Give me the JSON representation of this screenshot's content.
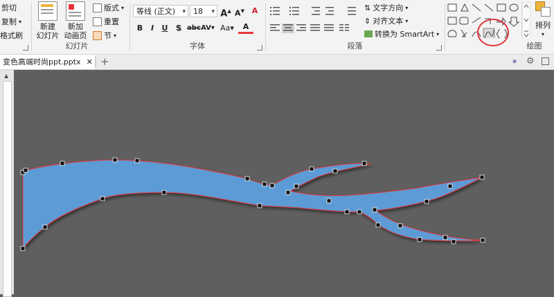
{
  "ribbon": {
    "clipboard": {
      "cut": "剪切",
      "copy": "复制",
      "format_painter": "格式刷"
    },
    "slides": {
      "new_slide": "新建幻灯片",
      "new_slide_line1": "新建",
      "new_slide_line2": "幻灯片",
      "new_anim_page_line1": "新加",
      "new_anim_page_line2": "动画页",
      "layout": "版式",
      "reset": "重置",
      "section": "节",
      "label": "幻灯片"
    },
    "font": {
      "font_name": "等线 (正文)",
      "font_size": "18",
      "bold": "B",
      "italic": "I",
      "underline": "U",
      "shadow": "S",
      "spacing": "AV",
      "case": "Aa",
      "label": "字体"
    },
    "paragraph": {
      "text_direction": "文字方向",
      "align_text": "对齐文本",
      "smartart": "转换为 SmartArt",
      "label": "段落"
    },
    "drawing": {
      "arrange": "排列",
      "label": "绘图"
    }
  },
  "document_tab": {
    "title": "变色高端时尚ppt.pptx",
    "close": "✕",
    "add": "+"
  },
  "colors": {
    "shape_fill": "#5b9bd5",
    "shape_outline": "#e8343a",
    "highlight": "#e0393c",
    "canvas": "#5f5f5f"
  },
  "icons": {
    "cut": "scissors-icon",
    "copy": "copy-icon",
    "paint": "format-painter-icon",
    "curve": "curve-tool-icon"
  }
}
